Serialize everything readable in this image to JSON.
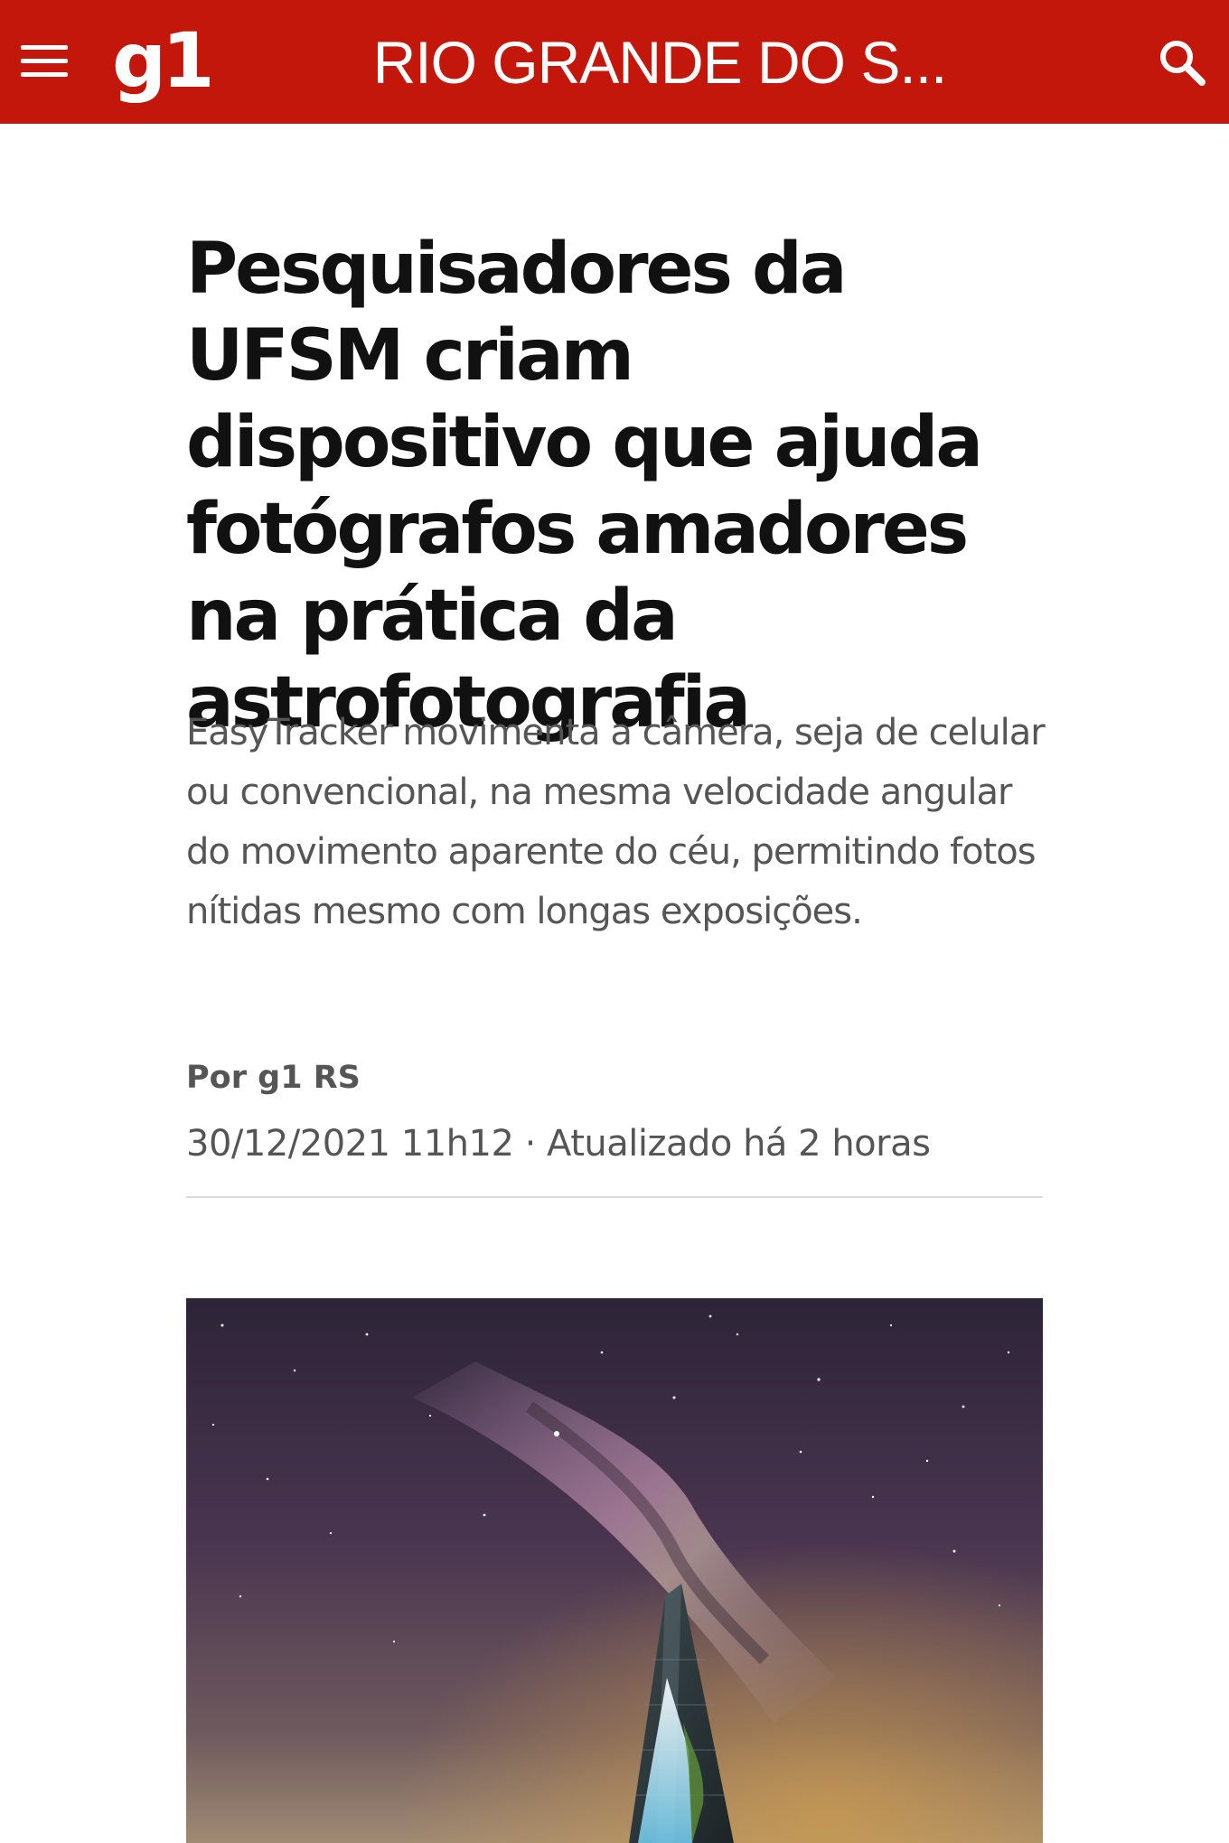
{
  "header": {
    "logo": "g1",
    "section_title": "RIO GRANDE DO S..."
  },
  "icons": {
    "menu": "hamburger-menu-icon",
    "search": "search-icon"
  },
  "colors": {
    "header_background": "#c4170c",
    "header_text": "#ffffff",
    "headline_text": "#111111",
    "meta_text": "#555555"
  },
  "article": {
    "headline": "Pesquisadores da UFSM criam dispositivo que ajuda fotógrafos amadores na prática da astrofotografia",
    "subtitle": "EasyTracker movimenta a câmera, seja de celular ou convencional, na mesma velocidade angular do movimento aparente do céu, permitindo fotos nítidas mesmo com longas exposições.",
    "byline": "Por g1 RS",
    "dateline": "30/12/2021 11h12 · Atualizado há 2 horas"
  }
}
